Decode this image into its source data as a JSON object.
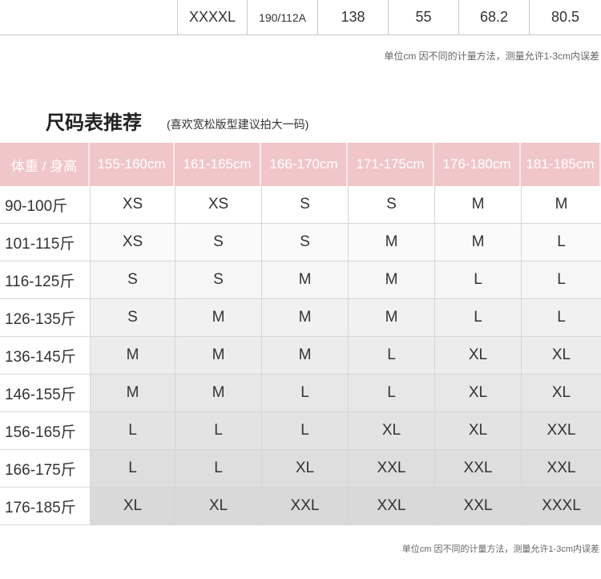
{
  "top_row": [
    "",
    "XXXXL",
    "190/112A",
    "138",
    "55",
    "68.2",
    "80.5"
  ],
  "note": "单位cm 因不同的计量方法，测量允许1-3cm内误差",
  "title": "尺码表推荐",
  "subtitle": "(喜欢宽松版型建议拍大一码)",
  "table": {
    "headers": [
      "体重 / 身高",
      "155-160cm",
      "161-165cm",
      "166-170cm",
      "171-175cm",
      "176-180cm",
      "181-185cm"
    ],
    "rows": [
      {
        "weight": "90-100斤",
        "sizes": [
          "XS",
          "XS",
          "S",
          "S",
          "M",
          "M"
        ]
      },
      {
        "weight": "101-115斤",
        "sizes": [
          "XS",
          "S",
          "S",
          "M",
          "M",
          "L"
        ]
      },
      {
        "weight": "116-125斤",
        "sizes": [
          "S",
          "S",
          "M",
          "M",
          "L",
          "L"
        ]
      },
      {
        "weight": "126-135斤",
        "sizes": [
          "S",
          "M",
          "M",
          "M",
          "L",
          "L"
        ]
      },
      {
        "weight": "136-145斤",
        "sizes": [
          "M",
          "M",
          "M",
          "L",
          "XL",
          "XL"
        ]
      },
      {
        "weight": "146-155斤",
        "sizes": [
          "M",
          "M",
          "L",
          "L",
          "XL",
          "XL"
        ]
      },
      {
        "weight": "156-165斤",
        "sizes": [
          "L",
          "L",
          "L",
          "XL",
          "XL",
          "XXL"
        ]
      },
      {
        "weight": "166-175斤",
        "sizes": [
          "L",
          "L",
          "XL",
          "XXL",
          "XXL",
          "XXL"
        ]
      },
      {
        "weight": "176-185斤",
        "sizes": [
          "XL",
          "XL",
          "XXL",
          "XXL",
          "XXL",
          "XXXL"
        ]
      }
    ]
  },
  "colors": {
    "header_bg": "#f0c6c8",
    "header_text": "#ffffff"
  }
}
